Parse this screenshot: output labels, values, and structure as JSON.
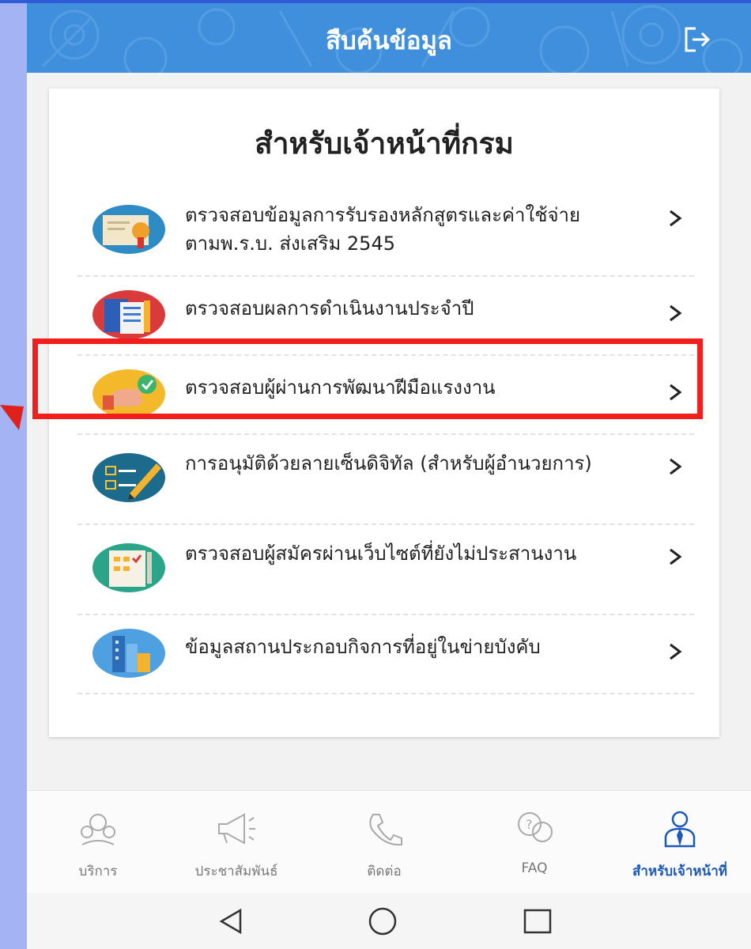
{
  "header": {
    "title": "สืบค้นข้อมูล",
    "logout_icon": "logout-icon"
  },
  "card": {
    "title": "สำหรับเจ้าหน้าที่กรม",
    "items": [
      {
        "label": "ตรวจสอบข้อมูลการรับรองหลักสูตรและค่าใช้จ่ายตามพ.ร.บ. ส่งเสริม 2545",
        "icon": "certificate-icon"
      },
      {
        "label": "ตรวจสอบผลการดำเนินงานประจำปี",
        "icon": "documents-icon"
      },
      {
        "label": "ตรวจสอบผู้ผ่านการพัฒนาฝีมือแรงงาน",
        "icon": "thumbs-up-check-icon"
      },
      {
        "label": "การอนุมัติด้วยลายเซ็นดิจิทัล (สำหรับผู้อำนวยการ)",
        "icon": "digital-signature-icon"
      },
      {
        "label": "ตรวจสอบผู้สมัครผ่านเว็บไซต์ที่ยังไม่ประสานงาน",
        "icon": "applicant-list-icon"
      },
      {
        "label": "ข้อมูลสถานประกอบกิจการที่อยู่ในข่ายบังคับ",
        "icon": "buildings-icon"
      }
    ],
    "arrow_glyph": ">"
  },
  "highlight_color": "#f21d1d",
  "bottom_nav": {
    "items": [
      {
        "label": "บริการ",
        "icon": "service-icon"
      },
      {
        "label": "ประชาสัมพันธ์",
        "icon": "megaphone-icon"
      },
      {
        "label": "ติดต่อ",
        "icon": "phone-icon"
      },
      {
        "label": "FAQ",
        "icon": "faq-icon"
      },
      {
        "label": "สำหรับเจ้าหน้าที่",
        "icon": "officer-icon"
      }
    ],
    "active_color": "#1b58b8"
  },
  "system_nav": [
    "back-icon",
    "home-icon",
    "recents-icon"
  ]
}
